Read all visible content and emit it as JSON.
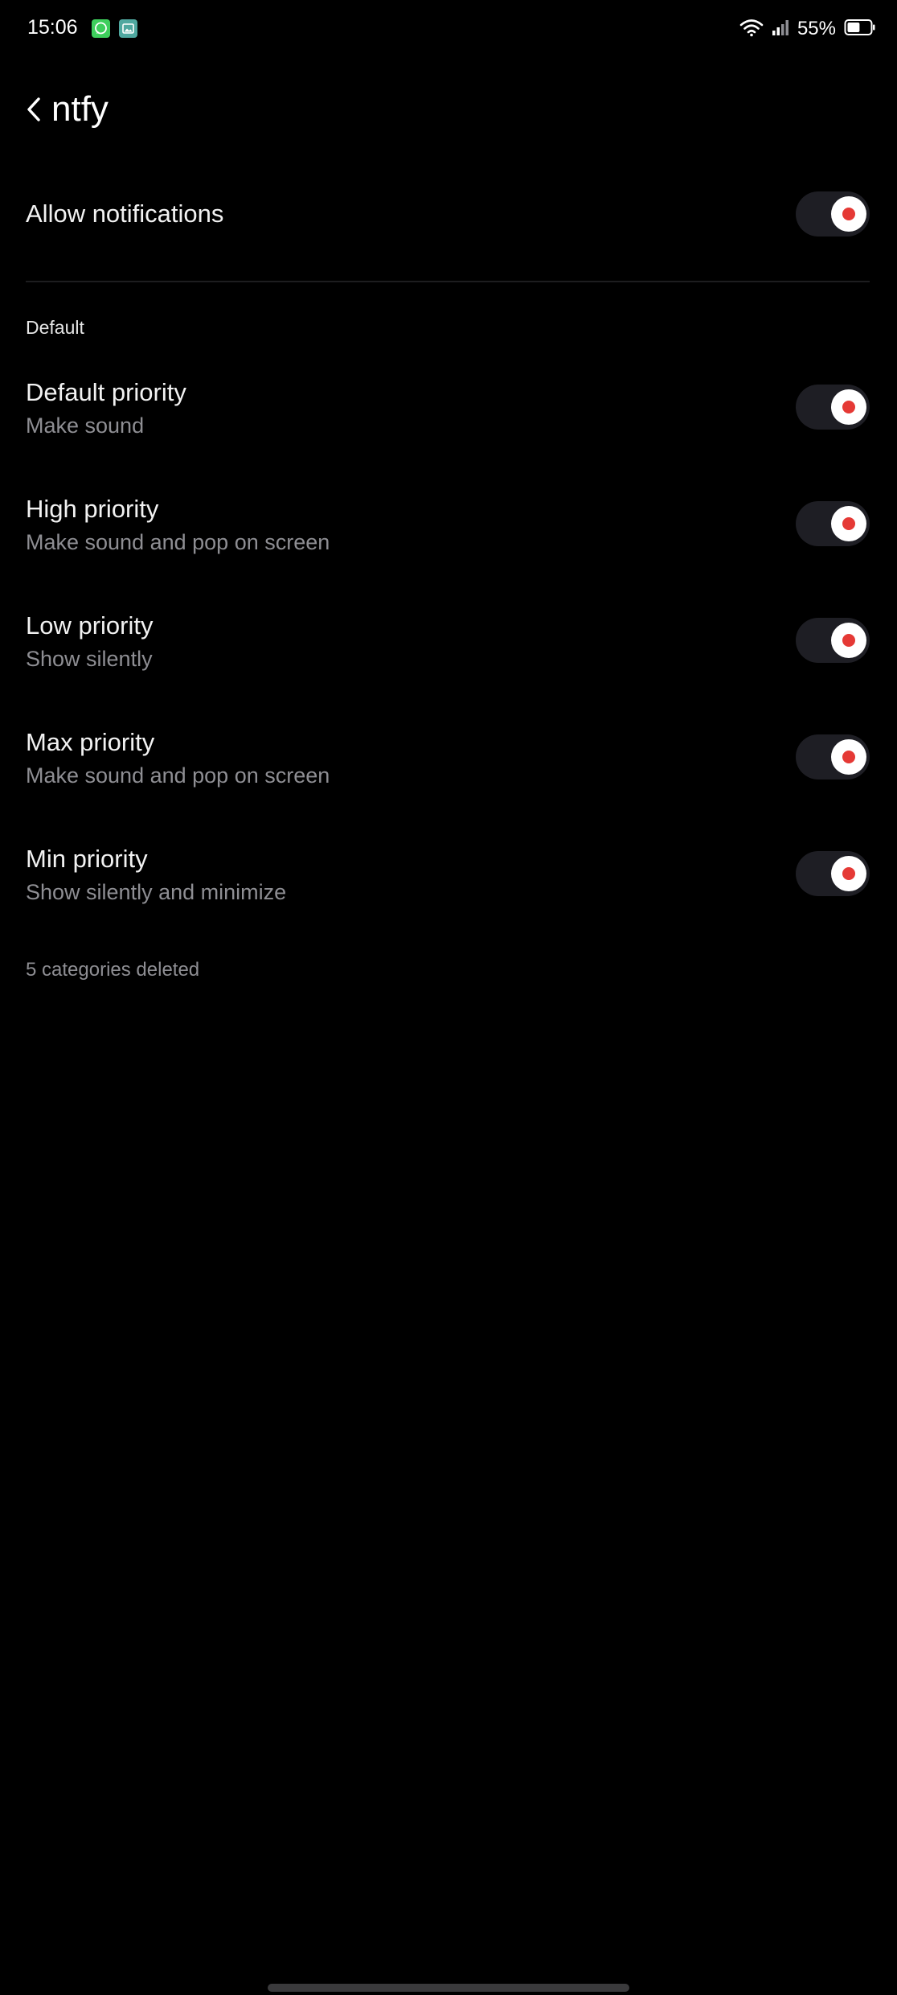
{
  "status_bar": {
    "time": "15:06",
    "notification_icons": [
      "whatsapp-icon",
      "gallery-icon"
    ],
    "status_icons": [
      "wifi-icon",
      "signal-icon",
      "battery-icon"
    ],
    "battery_percent": "55%",
    "battery_level": 0.55
  },
  "header": {
    "back_icon": "chevron-left-icon",
    "title": "ntfy"
  },
  "allow_notifications": {
    "label": "Allow notifications",
    "enabled": true
  },
  "section": {
    "label": "Default"
  },
  "channels": [
    {
      "title": "Default priority",
      "subtitle": "Make sound",
      "enabled": true
    },
    {
      "title": "High priority",
      "subtitle": "Make sound and pop on screen",
      "enabled": true
    },
    {
      "title": "Low priority",
      "subtitle": "Show silently",
      "enabled": true
    },
    {
      "title": "Max priority",
      "subtitle": "Make sound and pop on screen",
      "enabled": true
    },
    {
      "title": "Min priority",
      "subtitle": "Show silently and minimize",
      "enabled": true
    }
  ],
  "footer": {
    "note": "5 categories deleted"
  },
  "colors": {
    "background": "#000000",
    "toggle_track": "#1e1e24",
    "toggle_knob": "#ffffff",
    "toggle_accent": "#e53935",
    "secondary_text": "#8e8e93"
  }
}
